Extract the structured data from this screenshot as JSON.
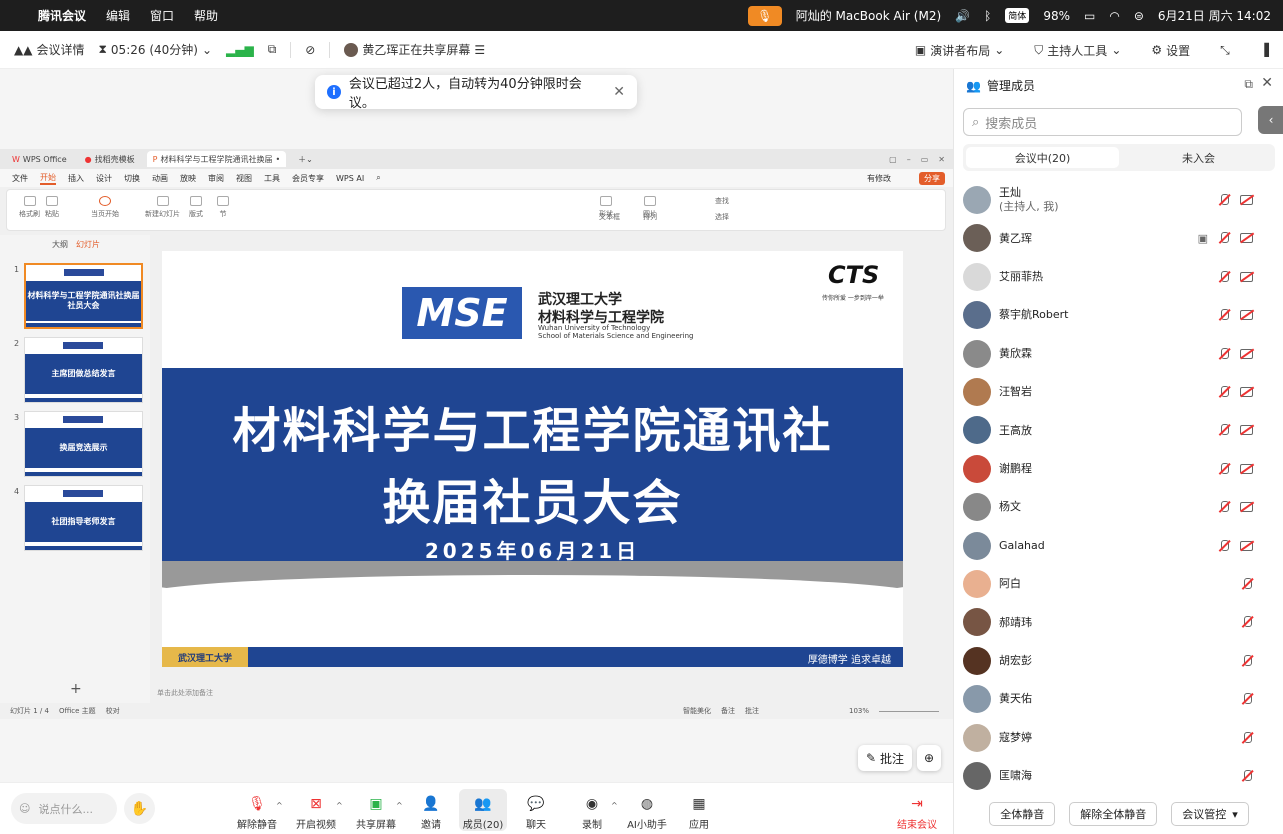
{
  "menubar": {
    "app": "腾讯会议",
    "items": [
      "编辑",
      "窗口",
      "帮助"
    ],
    "device": "阿灿的 MacBook Air (M2)",
    "battery": "98%",
    "input_badge": "简体",
    "datetime": "6月21日 周六 14:02"
  },
  "meeting_bar": {
    "details": "会议详情",
    "timer": "05:26 (40分钟)",
    "sharing": "黄乙珲正在共享屏幕",
    "layout": "演讲者布局",
    "host_tools": "主持人工具",
    "settings": "设置"
  },
  "toast": {
    "message": "会议已超过2人，自动转为40分钟限时会议。"
  },
  "wps": {
    "tabs": [
      "WPS Office",
      "找稻壳模板",
      "材料科学与工程学院通讯社换届"
    ],
    "menu": [
      "文件",
      "开始",
      "插入",
      "设计",
      "切换",
      "动画",
      "放映",
      "审阅",
      "视图",
      "工具",
      "会员专享",
      "WPS AI"
    ],
    "active_menu": "开始",
    "ribbon": [
      "格式刷",
      "粘贴",
      "当页开始",
      "新建幻灯片",
      "版式",
      "节",
      "形状",
      "图片",
      "文本框",
      "排列",
      "查找",
      "选择"
    ],
    "thumb_header": [
      "大纲",
      "幻灯片"
    ],
    "thumbs": [
      {
        "num": "1",
        "text": "材料科学与工程学院通讯社换届社员大会"
      },
      {
        "num": "2",
        "text": "主席团做总结发言"
      },
      {
        "num": "3",
        "text": "换届竞选展示"
      },
      {
        "num": "4",
        "text": "社团指导老师发言"
      }
    ],
    "status": [
      "幻灯片 1 / 4",
      "Office 主题",
      "校对",
      "智能美化",
      "备注",
      "批注",
      "103%"
    ],
    "notes_hint": "单击此处添加备注",
    "share_btn": "分享",
    "edit_btn": "有修改"
  },
  "slide": {
    "logo_text": "MSE",
    "uni_cn": "武汉理工大学",
    "school_cn": "材料科学与工程学院",
    "uni_en": "Wuhan University of Technology",
    "school_en": "School of Materials Science and Engineering",
    "cts": "CTS",
    "cts_sub": "传你所爱 一步到岸一举",
    "title_line1": "材料科学与工程学院通讯社",
    "title_line2": "换届社员大会",
    "date": "2025年06月21日",
    "footer_logo": "武汉理工大学",
    "motto": "厚德博学 追求卓越"
  },
  "panel": {
    "title": "管理成员",
    "search_placeholder": "搜索成员",
    "tab_in": "会议中(20)",
    "tab_out": "未入会",
    "members": [
      {
        "name": "王灿",
        "sub": "(主持人, 我)",
        "video": true
      },
      {
        "name": "黄乙珲",
        "sub": "",
        "video": true,
        "share": true
      },
      {
        "name": "艾丽菲热",
        "sub": "",
        "video": true
      },
      {
        "name": "蔡宇航Robert",
        "sub": "",
        "video": true
      },
      {
        "name": "黄欣霖",
        "sub": "",
        "video": true
      },
      {
        "name": "汪智岩",
        "sub": "",
        "video": true
      },
      {
        "name": "王高放",
        "sub": "",
        "video": true
      },
      {
        "name": "谢鹏程",
        "sub": "",
        "video": true
      },
      {
        "name": "杨文",
        "sub": "",
        "video": true
      },
      {
        "name": "Galahad",
        "sub": "",
        "video": true
      },
      {
        "name": "阿白",
        "sub": "",
        "video": false
      },
      {
        "name": "郝靖玮",
        "sub": "",
        "video": false
      },
      {
        "name": "胡宏彭",
        "sub": "",
        "video": false
      },
      {
        "name": "黄天佑",
        "sub": "",
        "video": false
      },
      {
        "name": "寇梦婷",
        "sub": "",
        "video": false
      },
      {
        "name": "匡啸海",
        "sub": "",
        "video": false
      }
    ],
    "mute_all": "全体静音",
    "unmute_all": "解除全体静音",
    "control": "会议管控"
  },
  "bottom": {
    "chat_placeholder": "说点什么...",
    "buttons": [
      "解除静音",
      "开启视频",
      "共享屏幕",
      "邀请",
      "成员(20)",
      "聊天",
      "录制",
      "AI小助手",
      "应用"
    ],
    "end": "结束会议",
    "annotate": "批注"
  }
}
